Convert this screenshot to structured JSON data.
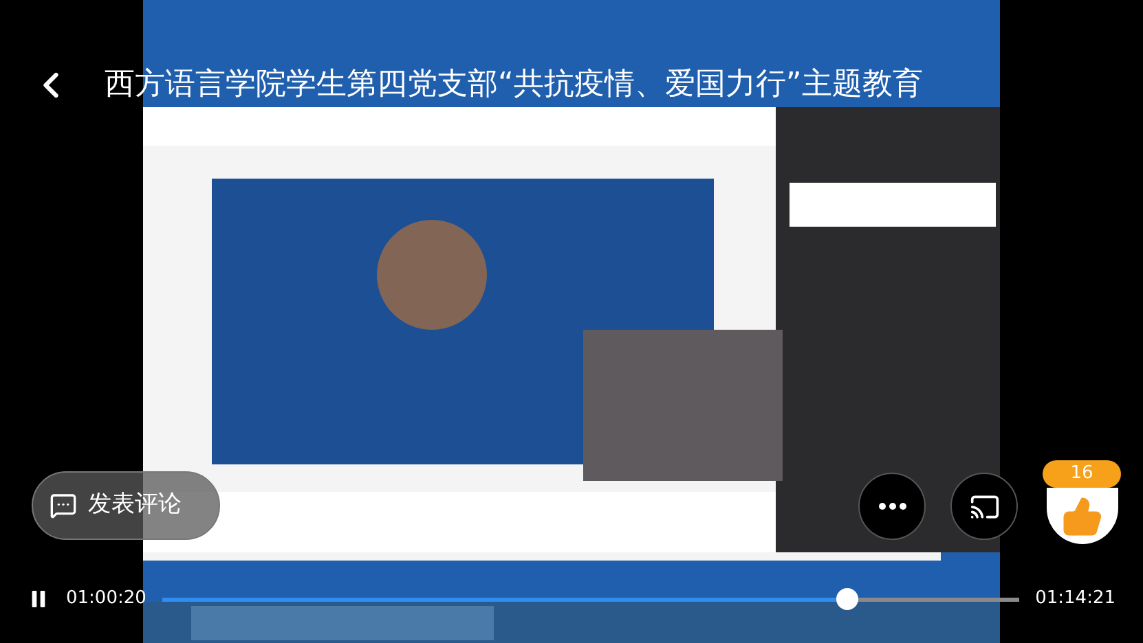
{
  "header": {
    "title": "西方语言学院学生第四党支部“共抗疫情、爱国力行”主题教育"
  },
  "comment_button": {
    "label": "发表评论"
  },
  "like": {
    "count": "16"
  },
  "player": {
    "playing": true,
    "elapsed": "01:00:20",
    "progress": {
      "level": 0.8
    },
    "duration": "01:14:21"
  }
}
